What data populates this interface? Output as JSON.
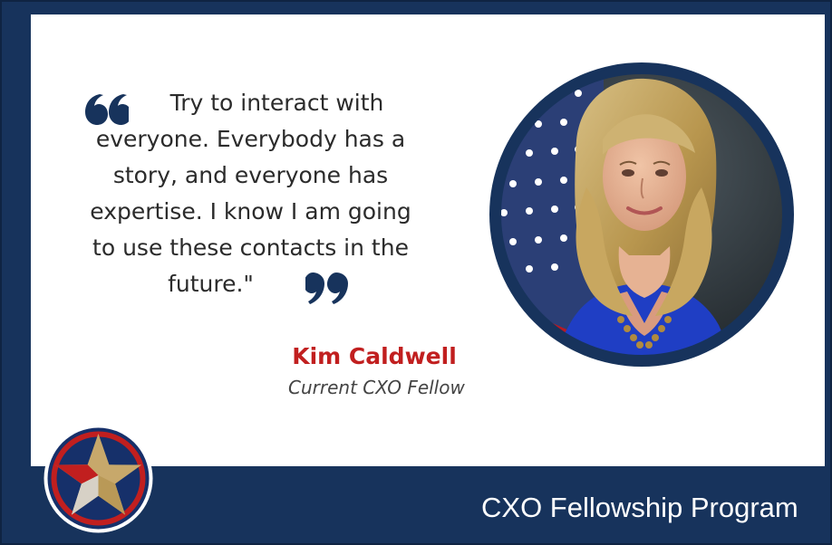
{
  "quote": {
    "lines": [
      "Try to interact with",
      "everyone. Everybody has a",
      "story, and everyone has",
      "expertise. I know I am going",
      "to use these contacts in the",
      "future.\""
    ],
    "open_icon": "open-quote-icon",
    "close_icon": "close-quote-icon"
  },
  "speaker": {
    "name": "Kim Caldwell",
    "role": "Current CXO Fellow"
  },
  "footer": {
    "title": "CXO Fellowship Program"
  },
  "colors": {
    "navy": "#17335c",
    "accent_red": "#c11f1f",
    "text": "#2b2b2b",
    "star_gold": "#c7a86b"
  },
  "images": {
    "portrait": "portrait-photo",
    "logo": "cxo-star-logo"
  }
}
